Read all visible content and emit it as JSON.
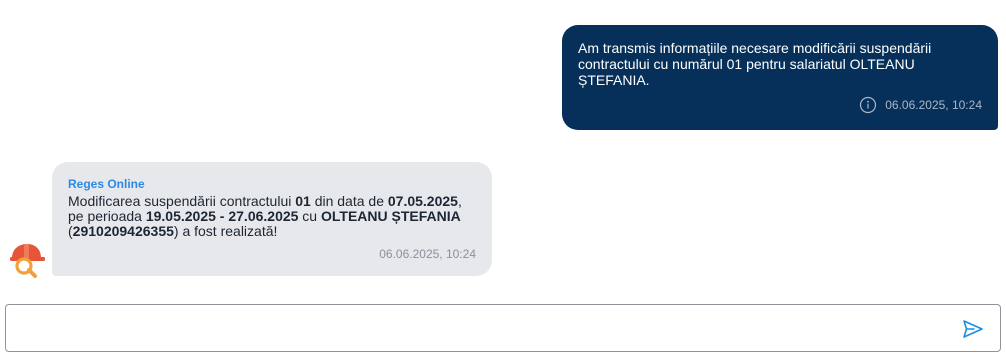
{
  "colors": {
    "outgoing_bubble": "#06305a",
    "incoming_bubble": "#e7e8ec",
    "sender_name": "#2a8ae6",
    "send_icon": "#1a8fe3"
  },
  "messages": {
    "outgoing": {
      "text": "Am transmis informațiile necesare modificării suspendării contractului cu numărul 01 pentru salariatul OLTEANU ȘTEFANIA.",
      "timestamp": "06.06.2025, 10:24",
      "icon": "info-icon"
    },
    "incoming": {
      "sender": "Reges Online",
      "parts": {
        "p1": "Modificarea suspendării contractului ",
        "contract_no": "01",
        "p2": " din data de ",
        "date": "07.05.2025",
        "p3": ", pe perioada ",
        "period": "19.05.2025 - 27.06.2025",
        "p4": " cu ",
        "employee": "OLTEANU  ȘTEFANIA",
        "p5": "  (",
        "cnp": "2910209426355",
        "p6": ") a fost realizată!"
      },
      "timestamp": "06.06.2025, 10:24",
      "avatar_icon": "reges-logo-icon"
    }
  },
  "composer": {
    "value": "",
    "placeholder": "",
    "send_icon": "send-icon"
  }
}
